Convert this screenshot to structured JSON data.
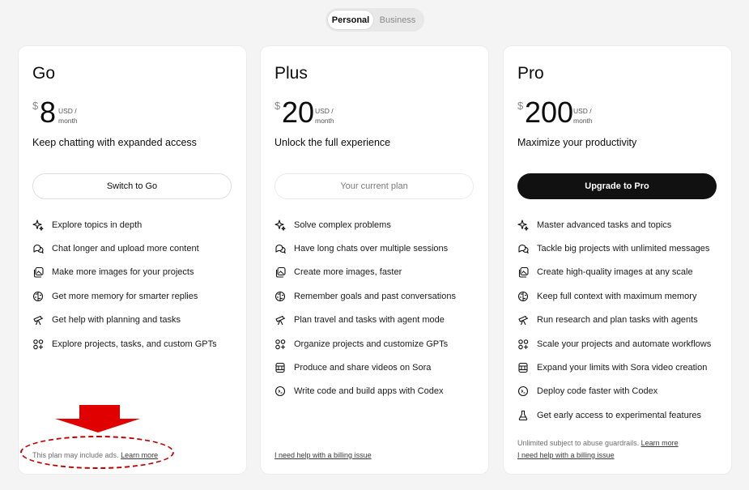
{
  "toggle": {
    "personal": "Personal",
    "business": "Business"
  },
  "plans": [
    {
      "name": "Go",
      "currency": "$",
      "amount": "8",
      "unit_line1": "USD /",
      "unit_line2": "month",
      "tagline": "Keep chatting with expanded access",
      "cta": "Switch to Go",
      "features": [
        {
          "icon": "sparkle-icon",
          "text": "Explore topics in depth"
        },
        {
          "icon": "chat-bubbles-icon",
          "text": "Chat longer and upload more content"
        },
        {
          "icon": "image-stack-icon",
          "text": "Make more images for your projects"
        },
        {
          "icon": "brain-icon",
          "text": "Get more memory for smarter replies"
        },
        {
          "icon": "telescope-icon",
          "text": "Get help with planning and tasks"
        },
        {
          "icon": "grid-icon",
          "text": "Explore projects, tasks, and custom GPTs"
        }
      ],
      "footer_text": "This plan may include ads.",
      "footer_link": "Learn more"
    },
    {
      "name": "Plus",
      "currency": "$",
      "amount": "20",
      "unit_line1": "USD /",
      "unit_line2": "month",
      "tagline": "Unlock the full experience",
      "cta": "Your current plan",
      "features": [
        {
          "icon": "sparkle-icon",
          "text": "Solve complex problems"
        },
        {
          "icon": "chat-bubbles-icon",
          "text": "Have long chats over multiple sessions"
        },
        {
          "icon": "image-stack-icon",
          "text": "Create more images, faster"
        },
        {
          "icon": "brain-icon",
          "text": "Remember goals and past conversations"
        },
        {
          "icon": "telescope-icon",
          "text": "Plan travel and tasks with agent mode"
        },
        {
          "icon": "grid-icon",
          "text": "Organize projects and customize GPTs"
        },
        {
          "icon": "film-icon",
          "text": "Produce and share videos on Sora"
        },
        {
          "icon": "code-icon",
          "text": "Write code and build apps with Codex"
        }
      ],
      "footer_link": "I need help with a billing issue"
    },
    {
      "name": "Pro",
      "currency": "$",
      "amount": "200",
      "unit_line1": "USD /",
      "unit_line2": "month",
      "tagline": "Maximize your productivity",
      "cta": "Upgrade to Pro",
      "features": [
        {
          "icon": "sparkle-icon",
          "text": "Master advanced tasks and topics"
        },
        {
          "icon": "chat-bubbles-icon",
          "text": "Tackle big projects with unlimited messages"
        },
        {
          "icon": "image-stack-icon",
          "text": "Create high-quality images at any scale"
        },
        {
          "icon": "brain-icon",
          "text": "Keep full context with maximum memory"
        },
        {
          "icon": "telescope-icon",
          "text": "Run research and plan tasks with agents"
        },
        {
          "icon": "grid-icon",
          "text": "Scale your projects and automate workflows"
        },
        {
          "icon": "film-icon",
          "text": "Expand your limits with Sora video creation"
        },
        {
          "icon": "code-icon",
          "text": "Deploy code faster with Codex"
        },
        {
          "icon": "flask-icon",
          "text": "Get early access to experimental features"
        }
      ],
      "footer_text": "Unlimited subject to abuse guardrails.",
      "footer_link": "Learn more",
      "footer_link2": "I need help with a billing issue"
    }
  ],
  "colors": {
    "annotation": "#e00000",
    "cta_dark": "#111111",
    "background": "#f4f4f4"
  }
}
